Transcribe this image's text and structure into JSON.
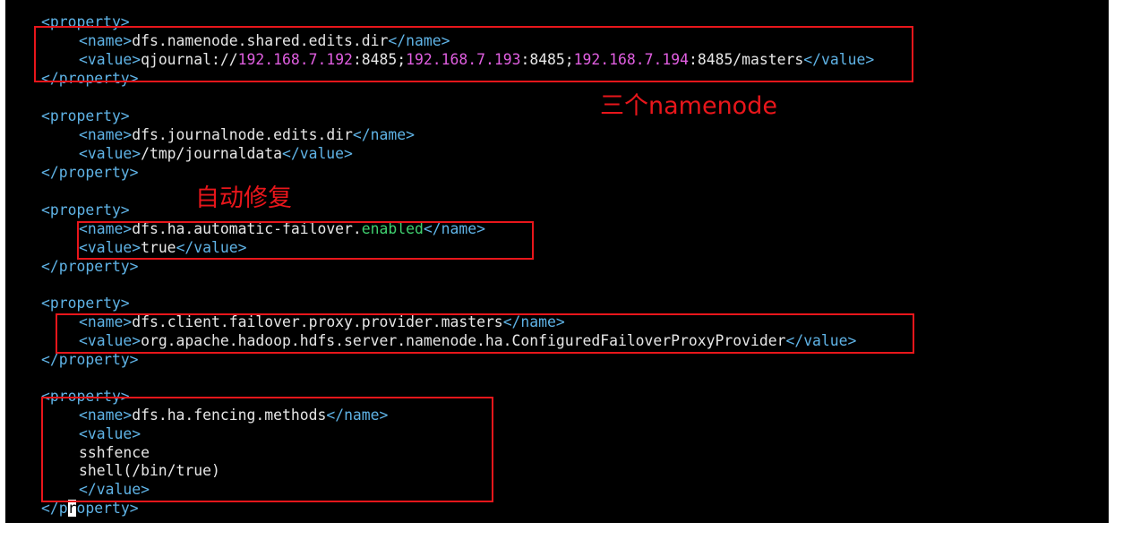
{
  "colors": {
    "background": "#000000",
    "tag": "#5fb3e6",
    "text": "#e6e6e6",
    "ip": "#e05ee0",
    "keyword": "#3fd16f",
    "annotation": "#e8161b"
  },
  "tags": {
    "property_open": "<property>",
    "property_close": "</property>",
    "name_open": "<name>",
    "name_close": "</name>",
    "value_open": "<value>",
    "value_close": "</value>"
  },
  "block1": {
    "name": "dfs.namenode.shared.edits.dir",
    "v_prefix": "qjournal://",
    "ip1": "192.168.7.192",
    "port1": ":8485;",
    "ip2": "192.168.7.193",
    "port2": ":8485;",
    "ip3": "192.168.7.194",
    "port3": ":8485/masters"
  },
  "block2": {
    "name": "dfs.journalnode.edits.dir",
    "value": "/tmp/journaldata"
  },
  "block3": {
    "name_a": "dfs.ha.automatic-failover.",
    "name_b": "enabled",
    "value": "true"
  },
  "block4": {
    "name": "dfs.client.failover.proxy.provider.masters",
    "value": "org.apache.hadoop.hdfs.server.namenode.ha.ConfiguredFailoverProxyProvider"
  },
  "block5": {
    "name": "dfs.ha.fencing.methods",
    "line1": "sshfence",
    "line2": "shell(/bin/true)"
  },
  "cursor_line": {
    "before": "</p",
    "cursor_char": "r",
    "after": "operty>"
  },
  "annotations": {
    "namenode": "三个namenode",
    "failover": "自动修复"
  }
}
